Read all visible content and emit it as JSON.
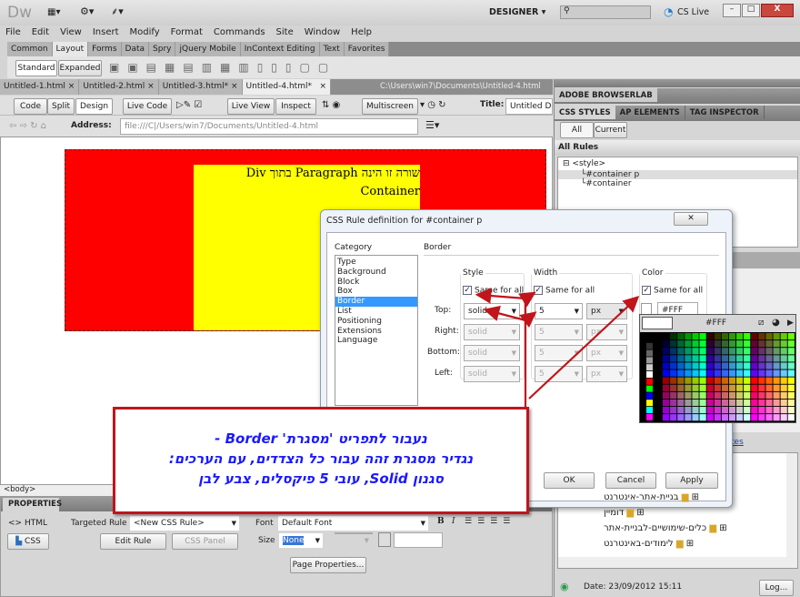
{
  "app": {
    "logo": "Dw",
    "workspace": "DESIGNER",
    "search_placeholder": "",
    "cs_live": "CS Live"
  },
  "menu": [
    "File",
    "Edit",
    "View",
    "Insert",
    "Modify",
    "Format",
    "Commands",
    "Site",
    "Window",
    "Help"
  ],
  "insert_tabs": [
    "Common",
    "Layout",
    "Forms",
    "Data",
    "Spry",
    "jQuery Mobile",
    "InContext Editing",
    "Text",
    "Favorites"
  ],
  "insert_active": "Layout",
  "layout_buttons": {
    "standard": "Standard",
    "expanded": "Expanded"
  },
  "doc_tabs": [
    "Untitled-1.html",
    "Untitled-2.html",
    "Untitled-3.html*",
    "Untitled-4.html*"
  ],
  "doc_path": "C:\\Users\\win7\\Documents\\Untitled-4.html",
  "doc_toolbar": {
    "code": "Code",
    "split": "Split",
    "design": "Design",
    "live_code": "Live Code",
    "live_view": "Live View",
    "inspect": "Inspect",
    "multiscreen": "Multiscreen",
    "title_label": "Title:",
    "title_value": "Untitled Document"
  },
  "address": {
    "label": "Address:",
    "value": "file:///C|/Users/win7/Documents/Untitled-4.html"
  },
  "page_content": {
    "line1": "שורה זו הינה Paragraph בתוך Div",
    "line2": "Container",
    "container_color": "#FF0000",
    "paragraph_color": "#FFFF00"
  },
  "status_tag": "<body>",
  "properties": {
    "title": "PROPERTIES",
    "html": "HTML",
    "css": "CSS",
    "targeted_rule_label": "Targeted Rule",
    "targeted_rule": "<New CSS Rule>",
    "edit_rule": "Edit Rule",
    "css_panel": "CSS Panel",
    "font_label": "Font",
    "font": "Default Font",
    "size_label": "Size",
    "size": "None",
    "bold": "B",
    "italic": "I",
    "page_properties": "Page Properties..."
  },
  "right_panel": {
    "browserlab": "ADOBE BROWSERLAB",
    "tabs": [
      "CSS STYLES",
      "AP ELEMENTS",
      "TAG INSPECTOR"
    ],
    "all": "All",
    "current": "Current",
    "all_rules": "All Rules",
    "rules_root": "<style>",
    "rules": [
      "#container p",
      "#container"
    ],
    "link_partial": "tes",
    "files": [
      "בניית-אתר-אינטרנט",
      "דומיין",
      "כלים-שימושיים-לבניית-אתר",
      "לימודים-באינטרנט"
    ],
    "date": "Date: 23/09/2012 15:11",
    "log": "Log..."
  },
  "dialog": {
    "title": "CSS Rule definition for #container p",
    "category_label": "Category",
    "categories": [
      "Type",
      "Background",
      "Block",
      "Box",
      "Border",
      "List",
      "Positioning",
      "Extensions",
      "Language"
    ],
    "selected_category": "Border",
    "section": "Border",
    "style_label": "Style",
    "width_label": "Width",
    "color_label": "Color",
    "same_for_all": "Same for all",
    "sides": [
      "Top:",
      "Right:",
      "Bottom:",
      "Left:"
    ],
    "style_value": "solid",
    "width_value": "5",
    "unit": "px",
    "color_value": "#FFF",
    "ok": "OK",
    "cancel": "Cancel",
    "apply": "Apply"
  },
  "color_picker": {
    "current": "#FFF"
  },
  "callout": {
    "line1": "נעבור לתפריט 'מסגרת' Border -",
    "line2": "נגדיר מסגרת זהה עבור כל הצדדים, עם הערכים:",
    "line3": "סגנון Solid, עובי 5 פיקסלים, צבע לבן",
    "border_color": "#C0151B",
    "text_color": "#1A1AFF"
  }
}
